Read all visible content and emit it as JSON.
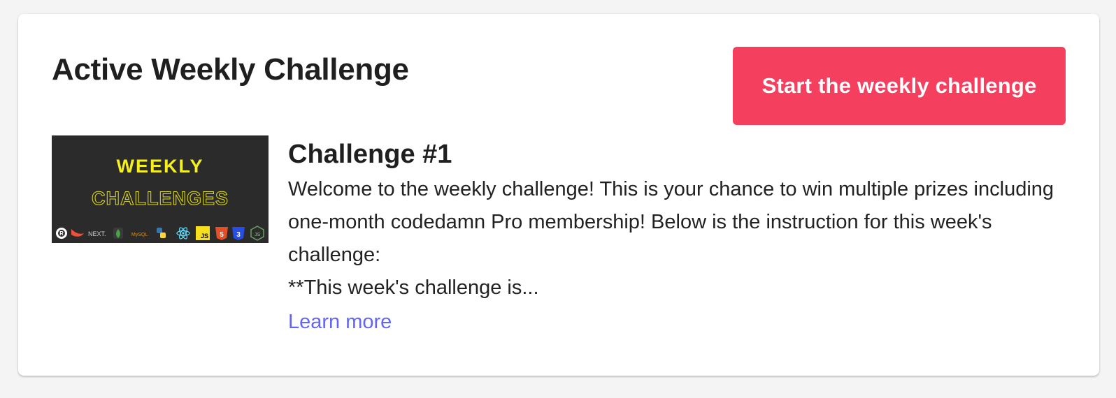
{
  "card": {
    "title": "Active Weekly Challenge",
    "start_button_label": "Start the weekly challenge"
  },
  "challenge": {
    "thumbnail": {
      "line1": "WEEKLY",
      "line2": "CHALLENGES",
      "tech_icons": [
        "rust-icon",
        "swift-icon",
        "nextjs-icon",
        "mongodb-icon",
        "mysql-icon",
        "python-icon",
        "react-icon",
        "javascript-icon",
        "html5-icon",
        "css3-icon",
        "nodejs-icon"
      ],
      "tech_labels": {
        "nextjs": "NEXT.",
        "mysql": "MySQL",
        "javascript": "JS"
      }
    },
    "title": "Challenge #1",
    "description": "Welcome to the weekly challenge! This is your chance to win multiple prizes including one-month codedamn Pro membership! Below is the instruction for this week's challenge:",
    "excerpt": "**This week's challenge is...",
    "learn_more_label": "Learn more"
  },
  "colors": {
    "accent_button": "#f43f5e",
    "link": "#6366f1",
    "thumbnail_bg": "#2b2b2b",
    "thumbnail_yellow": "#f5ef1c"
  }
}
